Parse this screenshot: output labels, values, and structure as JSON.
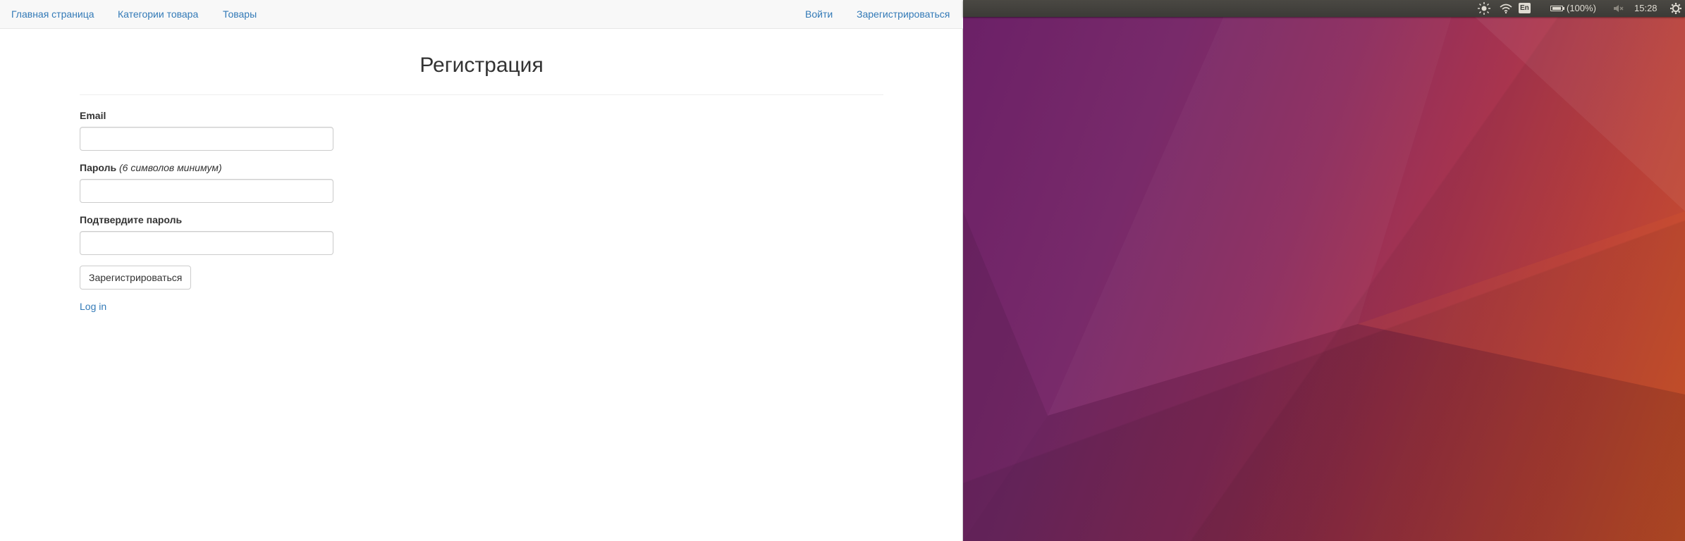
{
  "navbar": {
    "home": "Главная страница",
    "categories": "Категории товара",
    "products": "Товары",
    "login": "Войти",
    "register": "Зарегистрироваться"
  },
  "page_title": "Регистрация",
  "form": {
    "email_label": "Email",
    "email_value": "",
    "password_label": "Пароль",
    "password_hint": "(6 символов минимум)",
    "password_value": "",
    "confirm_label": "Подтвердите пароль",
    "confirm_value": "",
    "submit_label": "Зарегистрироваться",
    "login_link": "Log in"
  },
  "top_panel": {
    "keyboard_layout": "En",
    "battery": "(100%)",
    "clock": "15:28",
    "icons": [
      "brightness-icon",
      "wifi-icon",
      "keyboard-layout-icon",
      "battery-icon",
      "volume-muted-icon",
      "settings-gear-icon"
    ]
  },
  "colors": {
    "link": "#337ab7",
    "navbar_bg": "#f8f8f8",
    "panel_bg": "#3c3b37",
    "panel_text": "#dfdbd2",
    "wallpaper_left": "#6b2067",
    "wallpaper_right": "#dc5a2b"
  }
}
